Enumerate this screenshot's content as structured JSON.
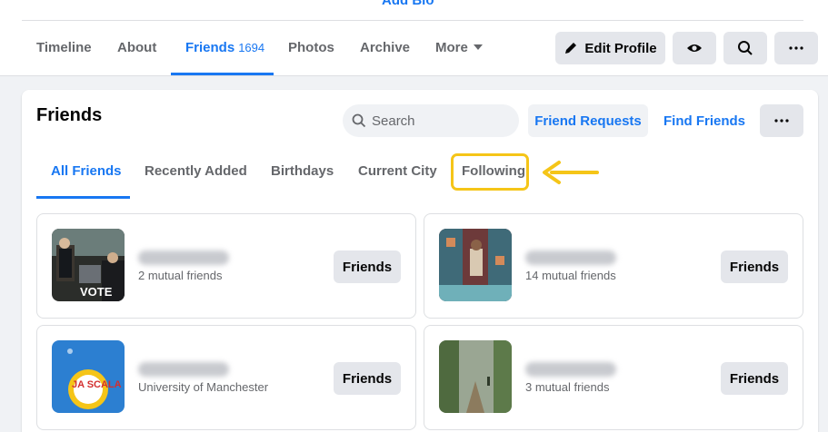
{
  "header": {
    "add_bio": "Add Bio",
    "tabs": [
      {
        "label": "Timeline"
      },
      {
        "label": "About"
      },
      {
        "label": "Friends",
        "count": "1694"
      },
      {
        "label": "Photos"
      },
      {
        "label": "Archive"
      },
      {
        "label": "More"
      }
    ],
    "edit_profile": "Edit Profile"
  },
  "friends": {
    "title": "Friends",
    "search_placeholder": "Search",
    "friend_requests": "Friend Requests",
    "find_friends": "Find Friends",
    "subtabs": [
      "All Friends",
      "Recently Added",
      "Birthdays",
      "Current City",
      "Following"
    ],
    "list": [
      {
        "name": "",
        "subtitle": "2 mutual friends",
        "button": "Friends",
        "photo_caption": "VOTE"
      },
      {
        "name": "",
        "subtitle": "14 mutual friends",
        "button": "Friends"
      },
      {
        "name": "",
        "subtitle": "University of Manchester",
        "button": "Friends",
        "photo_caption": "JA SCALA"
      },
      {
        "name": "",
        "subtitle": "3 mutual friends",
        "button": "Friends"
      }
    ]
  },
  "colors": {
    "accent": "#1877f2",
    "highlight": "#f5c518",
    "button_bg": "#e4e6eb",
    "page_bg": "#f0f2f5"
  }
}
